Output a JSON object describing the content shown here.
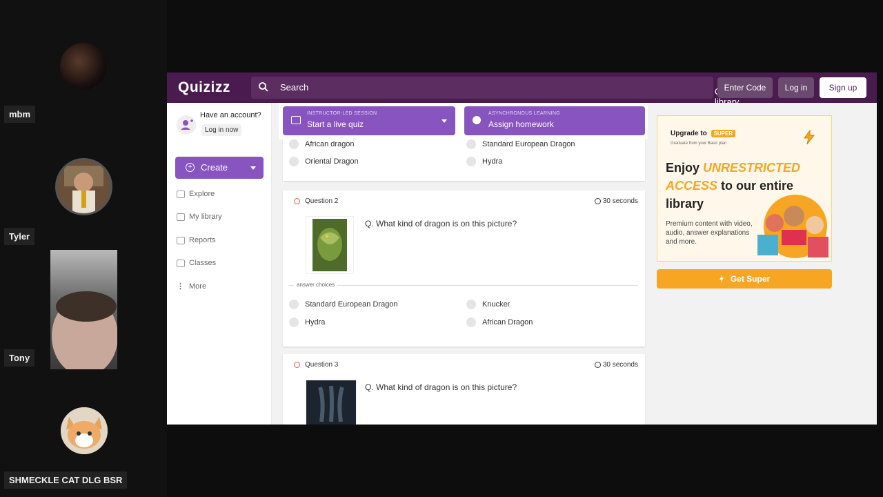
{
  "participants": [
    {
      "name": "mbm"
    },
    {
      "name": "Tyler"
    },
    {
      "name": "Tony"
    },
    {
      "name": "SHMECKLE CAT DLG BSR"
    }
  ],
  "app": {
    "logo": "Quizizz",
    "search_placeholder": "Search",
    "library_select": "Quizizz library",
    "enter_code": "Enter Code",
    "login": "Log in",
    "signup": "Sign up"
  },
  "sidebar": {
    "account_question": "Have an account?",
    "login_now": "Log in now",
    "create": "Create",
    "items": [
      {
        "label": "Explore",
        "icon": "explore-icon"
      },
      {
        "label": "My library",
        "icon": "library-icon"
      },
      {
        "label": "Reports",
        "icon": "reports-icon"
      },
      {
        "label": "Classes",
        "icon": "classes-icon"
      },
      {
        "label": "More",
        "icon": "more-icon"
      }
    ]
  },
  "session": {
    "live_small": "INSTRUCTOR-LED SESSION",
    "live_big": "Start a live quiz",
    "hw_small": "ASYNCHRONOUS LEARNING",
    "hw_big": "Assign homework"
  },
  "question1": {
    "choices": [
      "African dragon",
      "Standard European Dragon",
      "Oriental Dragon",
      "Hydra"
    ]
  },
  "question2": {
    "label": "Question 2",
    "time": "30 seconds",
    "text": "Q. What kind of dragon is on this picture?",
    "answer_label": "answer choices",
    "choices": [
      "Standard European Dragon",
      "Knucker",
      "Hydra",
      "African Dragon"
    ]
  },
  "question3": {
    "label": "Question 3",
    "time": "30 seconds",
    "text": "Q. What kind of dragon is on this picture?"
  },
  "promo": {
    "upgrade": "Upgrade to",
    "badge": "SUPER",
    "graduate": "Graduate from your Basic plan",
    "head1": "Enjoy",
    "head_accent": "UNRESTRICTED ACCESS",
    "head2": "to our entire library",
    "desc": "Premium content with video, audio, answer explanations and more.",
    "cta": "Get Super"
  },
  "colors": {
    "brand": "#4a1b4f",
    "primary": "#8854c0",
    "super": "#f6a623"
  }
}
